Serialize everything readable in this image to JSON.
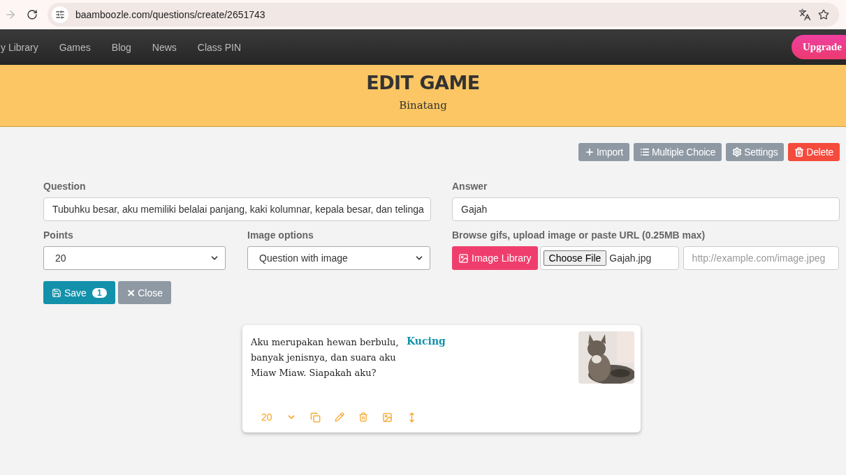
{
  "browser": {
    "url": "baamboozle.com/questions/create/2651743"
  },
  "nav": {
    "items": [
      "y Library",
      "Games",
      "Blog",
      "News",
      "Class PIN"
    ],
    "upgrade": "Upgrade"
  },
  "banner": {
    "title": "EDIT GAME",
    "subtitle": "Binatang"
  },
  "actions": [
    {
      "label": "Import",
      "kind": "plus"
    },
    {
      "label": "Multiple Choice",
      "kind": "list"
    },
    {
      "label": "Settings",
      "kind": "gear"
    },
    {
      "label": "Delete",
      "kind": "trash"
    }
  ],
  "form": {
    "question": {
      "label": "Question",
      "value": "Tubuhku besar, aku memiliki belalai panjang,  kaki kolumnar, kepala besar, dan telinga"
    },
    "answer": {
      "label": "Answer",
      "value": "Gajah"
    },
    "points": {
      "label": "Points",
      "value": "20"
    },
    "image_options": {
      "label": "Image options",
      "value": "Question with image"
    },
    "image": {
      "label": "Browse gifs, upload image or paste URL (0.25MB max)",
      "library_button": "Image Library",
      "file_button": "Choose File",
      "file_name": "Gajah.jpg",
      "url_placeholder": "http://example.com/image.jpeg"
    },
    "save": {
      "label": "Save",
      "badge": "1"
    },
    "close": "Close"
  },
  "card": {
    "question": "Aku merupakan hewan berbulu, banyak jenisnya, dan suara aku Miaw Miaw. Siapakah aku?",
    "answer": "Kucing",
    "points": "20"
  }
}
